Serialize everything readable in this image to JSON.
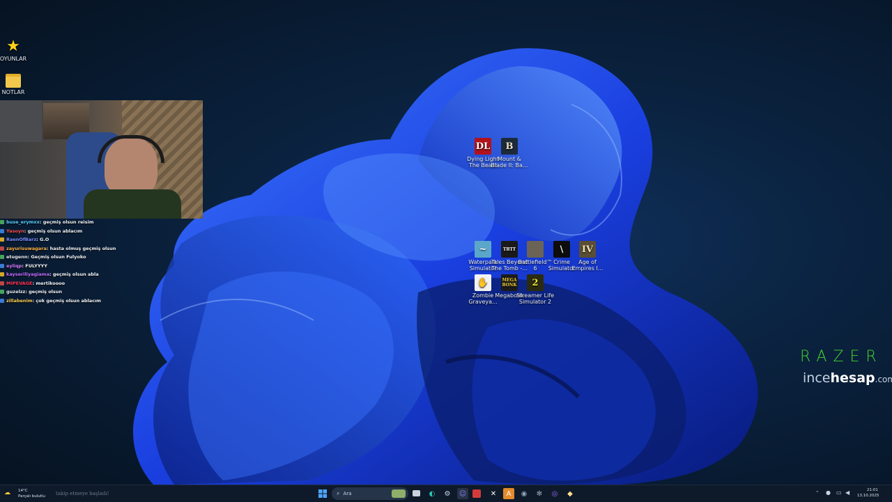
{
  "desktop_icons_left": [
    {
      "label": "OYUNLAR",
      "icon": "star-icon"
    },
    {
      "label": "NOTLAR",
      "icon": "folder-icon"
    }
  ],
  "desktop_icons_games": [
    {
      "label": "Dying Light The Beast",
      "glyph": "DL",
      "icon": "dying-light-icon"
    },
    {
      "label": "Mount & Blade II: Ba...",
      "glyph": "B",
      "icon": "bannerlord-icon"
    },
    {
      "label": "Waterpark Simulator",
      "glyph": "~",
      "icon": "waterpark-icon"
    },
    {
      "label": "Tales Beyond The Tomb -...",
      "glyph": "TBTT",
      "icon": "tales-tomb-icon"
    },
    {
      "label": "Battlefield™ 6",
      "glyph": "",
      "icon": "battlefield-icon"
    },
    {
      "label": "Crime Simulator",
      "glyph": "\\",
      "icon": "crime-simulator-icon"
    },
    {
      "label": "Age of Empires I...",
      "glyph": "IV",
      "icon": "age-of-empires-icon"
    },
    {
      "label": "Zombie Graveya...",
      "glyph": "✋",
      "icon": "zombie-graveyard-icon"
    },
    {
      "label": "Megabonk",
      "glyph": "MEGA BONK",
      "icon": "megabonk-icon"
    },
    {
      "label": "Streamer Life Simulator 2",
      "glyph": "2",
      "icon": "streamer-life-icon"
    }
  ],
  "chat": [
    {
      "user": "buse_erymxx",
      "msg": ": geçmiş olsun reisim",
      "color": "#5ad1ff"
    },
    {
      "user": "Yasoyn",
      "msg": ": geçmiş olsun ablacım",
      "color": "#ff4f4f"
    },
    {
      "user": "RaenOfBarz",
      "msg": ": G.O",
      "color": "#7b8cff"
    },
    {
      "user": "zayurisuwagara",
      "msg": ": hasta olmuş geçmiş olsun",
      "color": "#ffb347"
    },
    {
      "user": "etugenn",
      "msg": ": Geçmiş olsun Fulyoko",
      "color": "#e7ecf2"
    },
    {
      "user": "eyliqp",
      "msg": ": FULYYYY",
      "color": "#d777ff"
    },
    {
      "user": "kayseriliyagiama",
      "msg": ": geçmiş olsun abla",
      "color": "#c56bff"
    },
    {
      "user": "MIPEVAGE",
      "msg": ": mertikoooo",
      "color": "#ff3355"
    },
    {
      "user": "guzelzz",
      "msg": ": geçmiş olsun",
      "color": "#e7ecf2"
    },
    {
      "user": "zillabenim",
      "msg": ": çok geçmiş olsun ablacım",
      "color": "#ffcf4d"
    }
  ],
  "branding": {
    "razer": "RAZER",
    "incehesap_a": "ince",
    "incehesap_b": "hesap",
    "incehesap_c": ".com"
  },
  "taskbar": {
    "weather_temp": "14°C",
    "weather_desc": "Parçalı bulutlu",
    "ticker": "takip etmeye başladı!",
    "search_placeholder": "Ara",
    "time": "21:01",
    "date": "13.10.2025"
  },
  "colors": {
    "accent": "#0a4bff",
    "razer_green": "#44d62c"
  }
}
